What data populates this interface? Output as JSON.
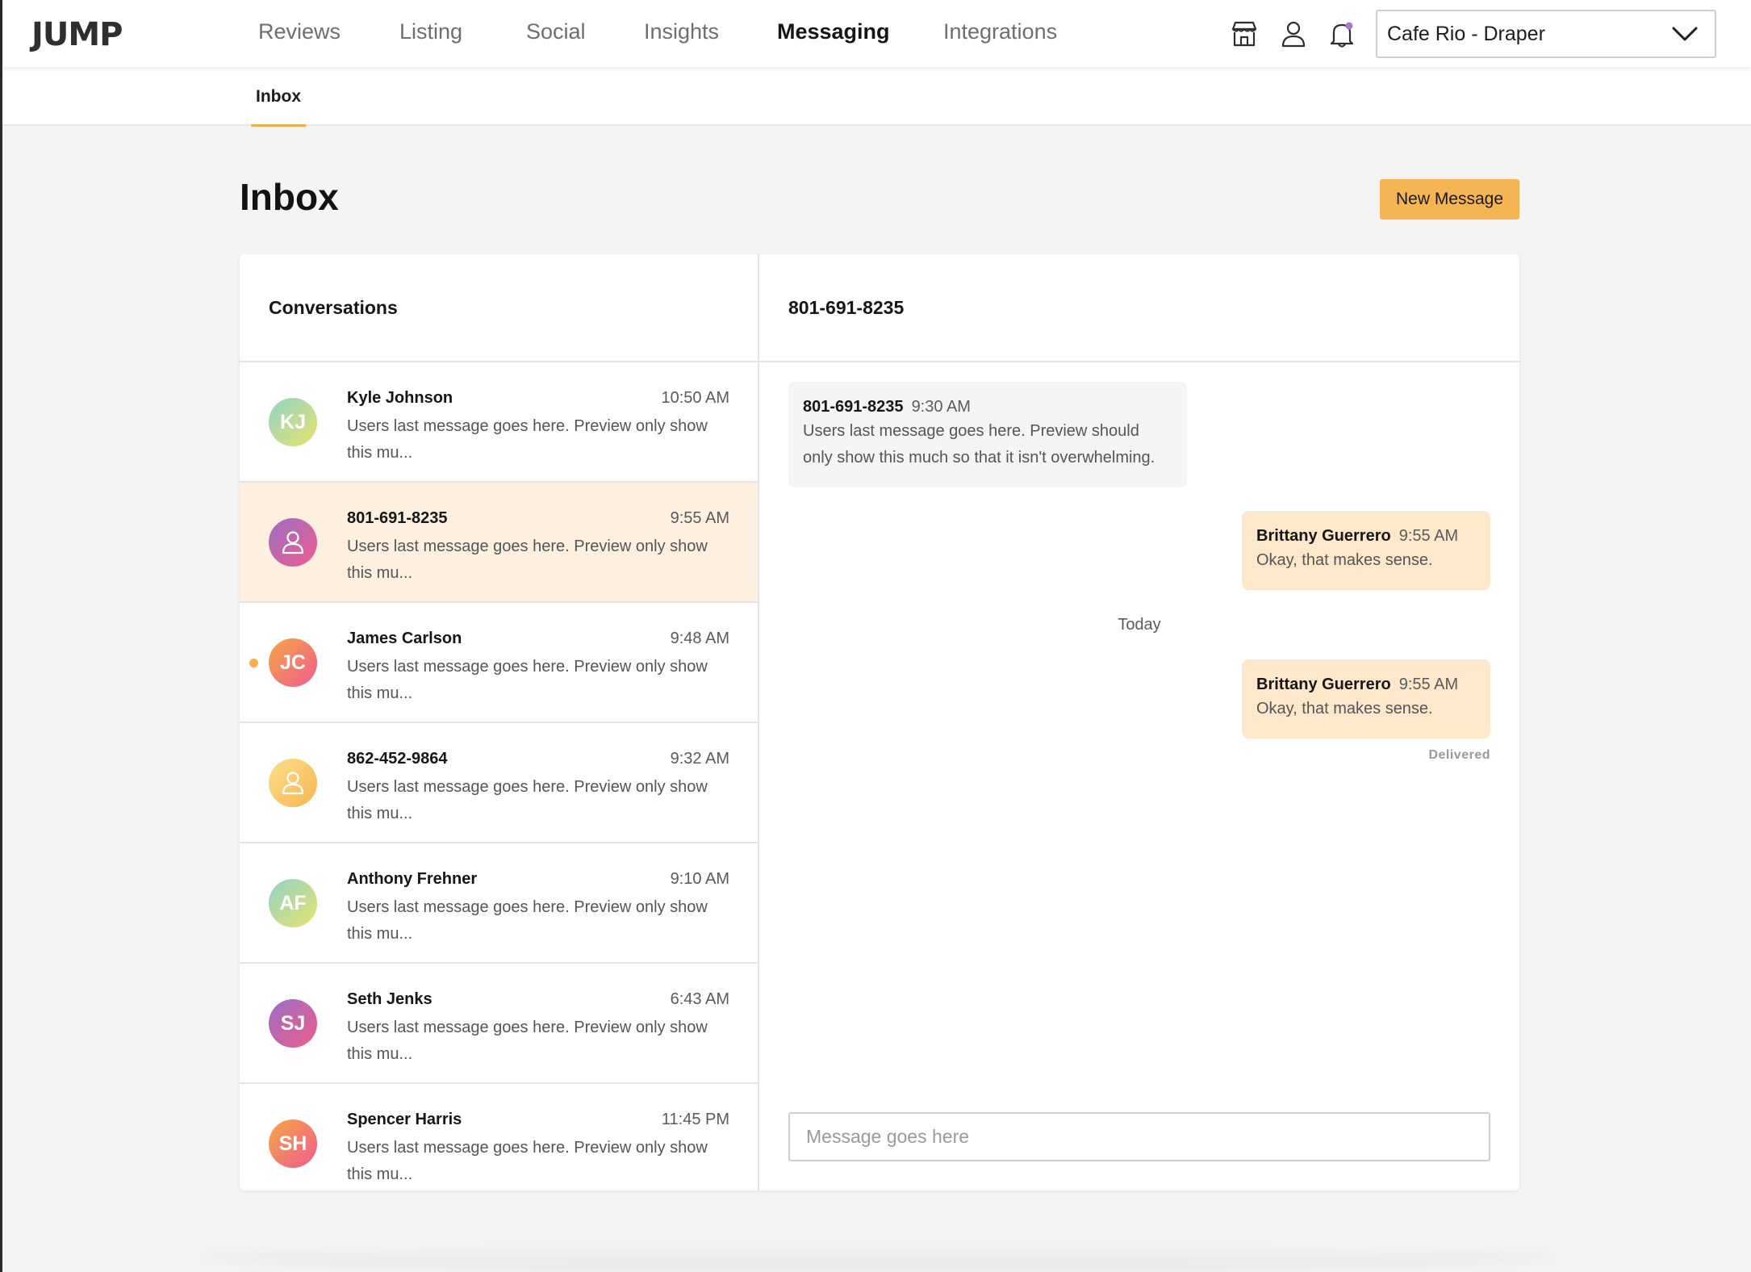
{
  "brand": {
    "logo": "JUMP"
  },
  "nav": {
    "items": [
      {
        "label": "Reviews",
        "active": false
      },
      {
        "label": "Listing",
        "active": false
      },
      {
        "label": "Social",
        "active": false
      },
      {
        "label": "Insights",
        "active": false
      },
      {
        "label": "Messaging",
        "active": true
      },
      {
        "label": "Integrations",
        "active": false
      }
    ],
    "icons": [
      "storefront-icon",
      "user-icon",
      "bell-notification-icon"
    ],
    "location": {
      "selected": "Cafe Rio - Draper"
    }
  },
  "subnav": {
    "tabs": [
      {
        "label": "Inbox",
        "active": true
      }
    ]
  },
  "page": {
    "title": "Inbox",
    "new_message_label": "New Message"
  },
  "conversations": {
    "header": "Conversations",
    "items": [
      {
        "name": "Kyle Johnson",
        "initials": "KJ",
        "time": "10:50 AM",
        "preview": "Users last message goes here. Preview only show this mu...",
        "selected": false,
        "unread": false,
        "avatar": "initials",
        "gradient": "green-yellow"
      },
      {
        "name": "801-691-8235",
        "initials": "",
        "time": "9:55 AM",
        "preview": "Users last message goes here. Preview only show this mu...",
        "selected": true,
        "unread": false,
        "avatar": "person-icon",
        "gradient": "purple-pink"
      },
      {
        "name": "James Carlson",
        "initials": "JC",
        "time": "9:48 AM",
        "preview": "Users last message goes here. Preview only show this mu...",
        "selected": false,
        "unread": true,
        "avatar": "initials",
        "gradient": "orange-pink"
      },
      {
        "name": "862-452-9864",
        "initials": "",
        "time": "9:32 AM",
        "preview": "Users last message goes here. Preview only show this mu...",
        "selected": false,
        "unread": false,
        "avatar": "person-icon",
        "gradient": "yellow-orange"
      },
      {
        "name": "Anthony Frehner",
        "initials": "AF",
        "time": "9:10 AM",
        "preview": "Users last message goes here. Preview only show this mu...",
        "selected": false,
        "unread": false,
        "avatar": "initials",
        "gradient": "green-yellow"
      },
      {
        "name": "Seth Jenks",
        "initials": "SJ",
        "time": "6:43 AM",
        "preview": "Users last message goes here. Preview only show this mu...",
        "selected": false,
        "unread": false,
        "avatar": "initials",
        "gradient": "purple-pink"
      },
      {
        "name": "Spencer Harris",
        "initials": "SH",
        "time": "11:45 PM",
        "preview": "Users last message goes here. Preview only show this mu...",
        "selected": false,
        "unread": false,
        "avatar": "initials",
        "gradient": "orange-pink"
      }
    ]
  },
  "chat": {
    "header": "801-691-8235",
    "messages": [
      {
        "sender": "801-691-8235",
        "time": "9:30 AM",
        "text": "Users last message goes here. Preview should only show this much so that it isn't overwhelming.",
        "direction": "incoming"
      },
      {
        "sender": "Brittany Guerrero",
        "time": "9:55 AM",
        "text": "Okay, that makes sense.",
        "direction": "outgoing"
      },
      {
        "sender": "Brittany Guerrero",
        "time": "9:55 AM",
        "text": "Okay, that makes sense.",
        "direction": "outgoing"
      }
    ],
    "day_divider": "Today",
    "status": "Delivered",
    "input": {
      "placeholder": "Message goes here",
      "value": ""
    }
  },
  "colors": {
    "accent": "#f6b552",
    "selected_row": "#fdf0e0",
    "outgoing_bubble": "#fde8cc",
    "incoming_bubble": "#f4f4f4",
    "unread_dot": "#f3ae4e"
  }
}
